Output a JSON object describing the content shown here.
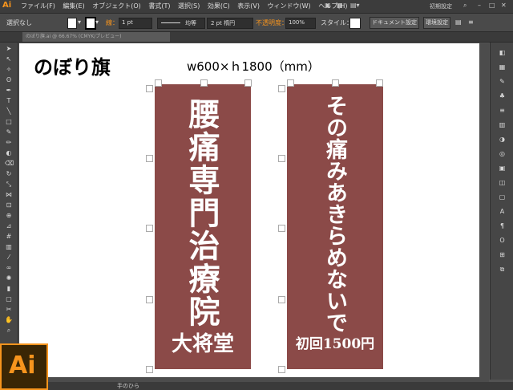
{
  "app": {
    "logo": "Ai",
    "preset": "初期設定"
  },
  "menu": {
    "items": [
      "ファイル(F)",
      "編集(E)",
      "オブジェクト(O)",
      "書式(T)",
      "選択(S)",
      "効果(C)",
      "表示(V)",
      "ウィンドウ(W)",
      "ヘルプ(H)"
    ]
  },
  "control": {
    "selection": "選択なし",
    "stroke_label": "線：",
    "stroke_value": "1 pt",
    "profile": "均等",
    "brush": "2 pt 楕円",
    "opacity_label": "不透明度：",
    "opacity_value": "100%",
    "style_label": "スタイル：",
    "doc_settings": "ドキュメント設定",
    "prefs": "環境設定"
  },
  "document": {
    "tab_title": "のぼり旗.ai @ 66.67% (CMYK/プレビュー)"
  },
  "canvas": {
    "heading": "のぼり旗",
    "dimensions": "w600×ｈ1800（mm）",
    "flag1": {
      "main": "腰痛専門治療院",
      "sub": "大将堂"
    },
    "flag2": {
      "main": "その痛みあきらめないで",
      "sub": "初回1500円"
    }
  },
  "status": {
    "tool": "手のひら"
  },
  "colors": {
    "flag": "#8b4a48",
    "accent": "#f7941d"
  }
}
